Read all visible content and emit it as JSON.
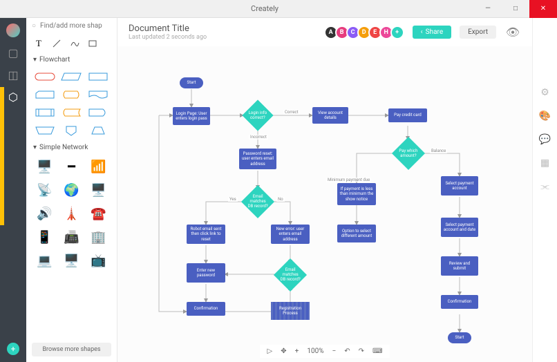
{
  "app_title": "Creately",
  "window": {
    "min": "—",
    "max": "□",
    "close": "✕"
  },
  "search": {
    "placeholder": "Find/add more shapes"
  },
  "doc": {
    "title": "Document Title",
    "subtitle": "Last updated 2 seconds ago"
  },
  "avatars": [
    {
      "bg": "#333",
      "label": "A"
    },
    {
      "bg": "#e73c7e",
      "label": "B"
    },
    {
      "bg": "#8b5cf6",
      "label": "C"
    },
    {
      "bg": "#f59e0b",
      "label": "D"
    },
    {
      "bg": "#ef4444",
      "label": "E"
    },
    {
      "bg": "#ec4899",
      "label": "H"
    },
    {
      "bg": "#2dd4bf",
      "label": "+"
    }
  ],
  "buttons": {
    "share": "Share",
    "export": "Export",
    "browse_more": "Browse more shapes"
  },
  "categories": {
    "flowchart": "Flowchart",
    "network": "Simple Network"
  },
  "zoom": "100%",
  "flowchart": {
    "start": "Start",
    "login_page": "Login Page: User enters login pass",
    "login_correct": "Login info correct?",
    "view_account": "View account details",
    "pay_credit": "Pay credit card",
    "correct": "Correct",
    "incorrect": "Incorrect",
    "password_reset": "Password reset: user enters email address",
    "pay_which": "Pay which amount?",
    "balance": "Balance",
    "min_due": "Minimum payment due",
    "email_matches1": "Email matches DB record?",
    "if_payment": "If payment is less than minimum the show notice",
    "select_payment": "Select payment account",
    "yes": "Yes",
    "no": "No",
    "robot_email": "Robot email sent then click link to reset",
    "new_error": "New error: user enters email address",
    "option_select": "Option to select different amount",
    "select_date": "Select payment account and date",
    "enter_new": "Enter new password",
    "email_matches2": "Email matches DB record?",
    "review": "Review and submit",
    "confirmation1": "Confirmation",
    "registration": "Registration Process",
    "confirmation2": "Confirmation",
    "start2": "Start"
  }
}
